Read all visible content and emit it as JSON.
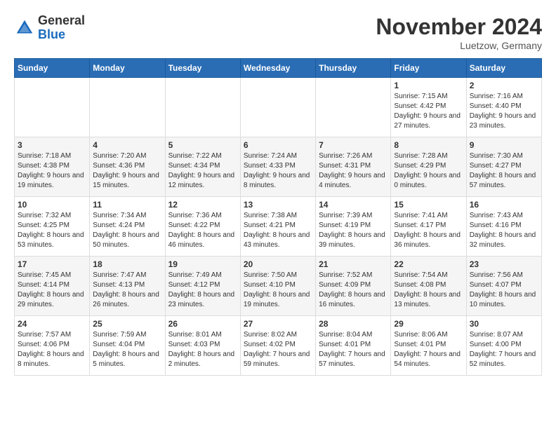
{
  "header": {
    "logo_general": "General",
    "logo_blue": "Blue",
    "month_title": "November 2024",
    "location": "Luetzow, Germany"
  },
  "weekdays": [
    "Sunday",
    "Monday",
    "Tuesday",
    "Wednesday",
    "Thursday",
    "Friday",
    "Saturday"
  ],
  "weeks": [
    [
      {
        "day": "",
        "info": ""
      },
      {
        "day": "",
        "info": ""
      },
      {
        "day": "",
        "info": ""
      },
      {
        "day": "",
        "info": ""
      },
      {
        "day": "",
        "info": ""
      },
      {
        "day": "1",
        "info": "Sunrise: 7:15 AM\nSunset: 4:42 PM\nDaylight: 9 hours and 27 minutes."
      },
      {
        "day": "2",
        "info": "Sunrise: 7:16 AM\nSunset: 4:40 PM\nDaylight: 9 hours and 23 minutes."
      }
    ],
    [
      {
        "day": "3",
        "info": "Sunrise: 7:18 AM\nSunset: 4:38 PM\nDaylight: 9 hours and 19 minutes."
      },
      {
        "day": "4",
        "info": "Sunrise: 7:20 AM\nSunset: 4:36 PM\nDaylight: 9 hours and 15 minutes."
      },
      {
        "day": "5",
        "info": "Sunrise: 7:22 AM\nSunset: 4:34 PM\nDaylight: 9 hours and 12 minutes."
      },
      {
        "day": "6",
        "info": "Sunrise: 7:24 AM\nSunset: 4:33 PM\nDaylight: 9 hours and 8 minutes."
      },
      {
        "day": "7",
        "info": "Sunrise: 7:26 AM\nSunset: 4:31 PM\nDaylight: 9 hours and 4 minutes."
      },
      {
        "day": "8",
        "info": "Sunrise: 7:28 AM\nSunset: 4:29 PM\nDaylight: 9 hours and 0 minutes."
      },
      {
        "day": "9",
        "info": "Sunrise: 7:30 AM\nSunset: 4:27 PM\nDaylight: 8 hours and 57 minutes."
      }
    ],
    [
      {
        "day": "10",
        "info": "Sunrise: 7:32 AM\nSunset: 4:25 PM\nDaylight: 8 hours and 53 minutes."
      },
      {
        "day": "11",
        "info": "Sunrise: 7:34 AM\nSunset: 4:24 PM\nDaylight: 8 hours and 50 minutes."
      },
      {
        "day": "12",
        "info": "Sunrise: 7:36 AM\nSunset: 4:22 PM\nDaylight: 8 hours and 46 minutes."
      },
      {
        "day": "13",
        "info": "Sunrise: 7:38 AM\nSunset: 4:21 PM\nDaylight: 8 hours and 43 minutes."
      },
      {
        "day": "14",
        "info": "Sunrise: 7:39 AM\nSunset: 4:19 PM\nDaylight: 8 hours and 39 minutes."
      },
      {
        "day": "15",
        "info": "Sunrise: 7:41 AM\nSunset: 4:17 PM\nDaylight: 8 hours and 36 minutes."
      },
      {
        "day": "16",
        "info": "Sunrise: 7:43 AM\nSunset: 4:16 PM\nDaylight: 8 hours and 32 minutes."
      }
    ],
    [
      {
        "day": "17",
        "info": "Sunrise: 7:45 AM\nSunset: 4:14 PM\nDaylight: 8 hours and 29 minutes."
      },
      {
        "day": "18",
        "info": "Sunrise: 7:47 AM\nSunset: 4:13 PM\nDaylight: 8 hours and 26 minutes."
      },
      {
        "day": "19",
        "info": "Sunrise: 7:49 AM\nSunset: 4:12 PM\nDaylight: 8 hours and 23 minutes."
      },
      {
        "day": "20",
        "info": "Sunrise: 7:50 AM\nSunset: 4:10 PM\nDaylight: 8 hours and 19 minutes."
      },
      {
        "day": "21",
        "info": "Sunrise: 7:52 AM\nSunset: 4:09 PM\nDaylight: 8 hours and 16 minutes."
      },
      {
        "day": "22",
        "info": "Sunrise: 7:54 AM\nSunset: 4:08 PM\nDaylight: 8 hours and 13 minutes."
      },
      {
        "day": "23",
        "info": "Sunrise: 7:56 AM\nSunset: 4:07 PM\nDaylight: 8 hours and 10 minutes."
      }
    ],
    [
      {
        "day": "24",
        "info": "Sunrise: 7:57 AM\nSunset: 4:06 PM\nDaylight: 8 hours and 8 minutes."
      },
      {
        "day": "25",
        "info": "Sunrise: 7:59 AM\nSunset: 4:04 PM\nDaylight: 8 hours and 5 minutes."
      },
      {
        "day": "26",
        "info": "Sunrise: 8:01 AM\nSunset: 4:03 PM\nDaylight: 8 hours and 2 minutes."
      },
      {
        "day": "27",
        "info": "Sunrise: 8:02 AM\nSunset: 4:02 PM\nDaylight: 7 hours and 59 minutes."
      },
      {
        "day": "28",
        "info": "Sunrise: 8:04 AM\nSunset: 4:01 PM\nDaylight: 7 hours and 57 minutes."
      },
      {
        "day": "29",
        "info": "Sunrise: 8:06 AM\nSunset: 4:01 PM\nDaylight: 7 hours and 54 minutes."
      },
      {
        "day": "30",
        "info": "Sunrise: 8:07 AM\nSunset: 4:00 PM\nDaylight: 7 hours and 52 minutes."
      }
    ]
  ]
}
